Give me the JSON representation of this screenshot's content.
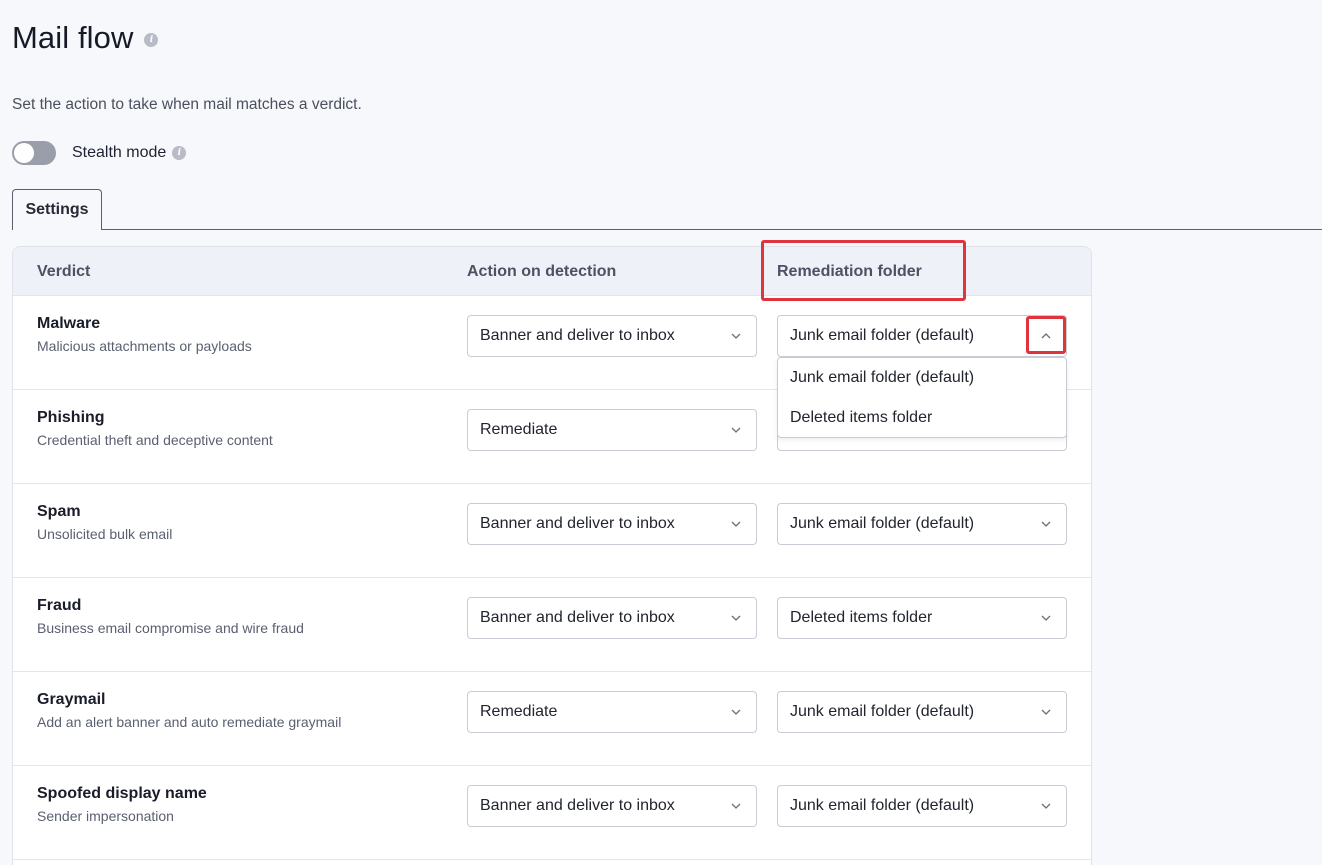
{
  "page": {
    "title": "Mail flow",
    "info_glyph": "i",
    "description": "Set the action to take when mail matches a verdict.",
    "stealth_mode": {
      "label": "Stealth mode",
      "enabled": false
    }
  },
  "tabs": [
    {
      "label": "Settings",
      "active": true
    }
  ],
  "table": {
    "headers": {
      "verdict": "Verdict",
      "action": "Action on detection",
      "folder": "Remediation folder"
    },
    "rows": [
      {
        "name": "Malware",
        "description": "Malicious attachments or payloads",
        "action": "Banner and deliver to inbox",
        "folder": "Junk email folder (default)"
      },
      {
        "name": "Phishing",
        "description": "Credential theft and deceptive content",
        "action": "Remediate",
        "folder": ""
      },
      {
        "name": "Spam",
        "description": "Unsolicited bulk email",
        "action": "Banner and deliver to inbox",
        "folder": "Junk email folder (default)"
      },
      {
        "name": "Fraud",
        "description": "Business email compromise and wire fraud",
        "action": "Banner and deliver to inbox",
        "folder": "Deleted items folder"
      },
      {
        "name": "Graymail",
        "description": "Add an alert banner and auto remediate graymail",
        "action": "Remediate",
        "folder": "Junk email folder (default)"
      },
      {
        "name": "Spoofed display name",
        "description": "Sender impersonation",
        "action": "Banner and deliver to inbox",
        "folder": "Junk email folder (default)"
      }
    ]
  },
  "folder_dropdown": {
    "open_row": "Malware",
    "options": [
      "Junk email folder (default)",
      "Deleted items folder"
    ]
  },
  "colors": {
    "highlight": "#e0343d",
    "toggle_off": "#9a9eab",
    "header_bg": "#eef1f8"
  },
  "icons": [
    "info-icon",
    "chevron-down-icon",
    "chevron-up-icon"
  ]
}
